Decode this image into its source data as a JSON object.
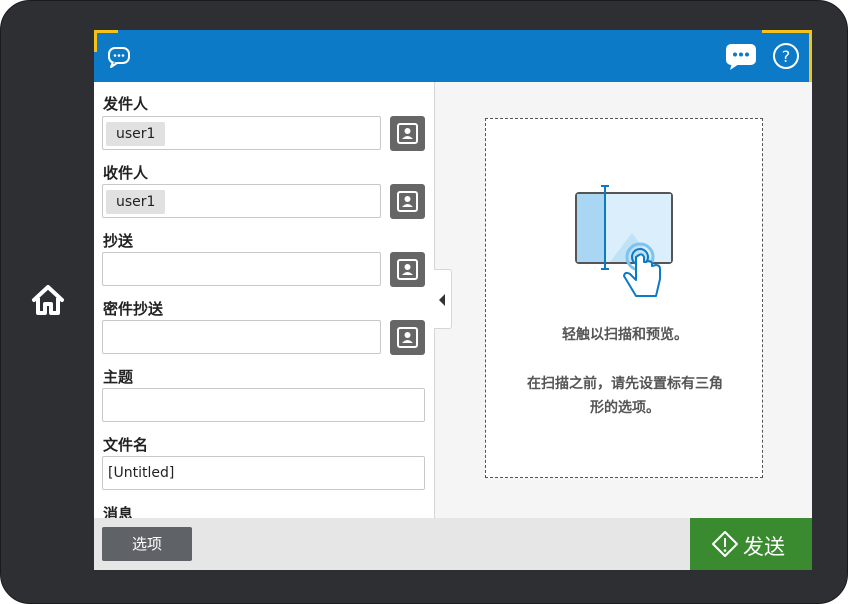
{
  "fields": {
    "from": {
      "label": "发件人",
      "chip": "user1"
    },
    "to": {
      "label": "收件人",
      "chip": "user1"
    },
    "cc": {
      "label": "抄送"
    },
    "bcc": {
      "label": "密件抄送"
    },
    "subject": {
      "label": "主题"
    },
    "filename": {
      "label": "文件名",
      "value": "[Untitled]"
    },
    "message": {
      "label": "消息"
    }
  },
  "preview": {
    "line1": "轻触以扫描和预览。",
    "line2": "在扫描之前，请先设置标有三角",
    "line3": "形的选项。"
  },
  "bottom": {
    "options_label": "选项",
    "send_label": "发送"
  },
  "colors": {
    "topbar": "#0c7ac6",
    "send": "#3a8a2f",
    "highlight": "#f4c21a"
  }
}
